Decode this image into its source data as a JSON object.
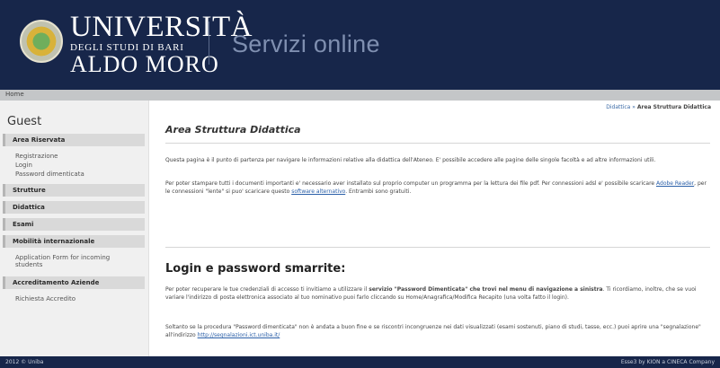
{
  "header": {
    "logo_line1": "UNIVERSITÀ",
    "logo_line2": "DEGLI STUDI DI BARI",
    "logo_line3": "ALDO MORO",
    "service_title": "Servizi online"
  },
  "breadbar": {
    "home": "Home"
  },
  "sidebar": {
    "title": "Guest",
    "area_riservata": "Area Riservata",
    "registrazione": "Registrazione",
    "login": "Login",
    "password_dimenticata": "Password dimenticata",
    "strutture": "Strutture",
    "didattica": "Didattica",
    "esami": "Esami",
    "mobilita": "Mobilità internazionale",
    "application_form_1": "Application Form for incoming",
    "application_form_2": "students",
    "accreditamento": "Accreditamento Aziende",
    "richiesta_accredito": "Richiesta Accredito"
  },
  "main": {
    "crumb_link": "Didattica",
    "crumb_sep": "»",
    "crumb_current": "Area Struttura Didattica",
    "title": "Area Struttura Didattica",
    "intro": "Questa pagina è il punto di partenza per navigare le informazioni relative alla didattica dell'Ateneo. E' possibile accedere alle pagine delle singole facoltà e ad altre informazioni utili.",
    "pdf_text_1": "Per poter stampare tutti i documenti importanti e' necessario aver installato sul proprio computer un programma per la lettura dei file pdf. Per connessioni adsl e' possibile scaricare ",
    "adobe_link": "Adobe Reader",
    "pdf_text_2": ", per le connessioni \"lente\" si puo' scaricare questo ",
    "alt_link": "software alternativo",
    "pdf_text_3": ". Entrambi sono gratuiti.",
    "login_title": "Login e password smarrite:",
    "recover_text_1": "Per poter recuperare le tue credenziali di accesso ti invitiamo a utilizzare il ",
    "recover_bold": "servizio \"Password Dimenticata\" che trovi nel menu di navigazione a sinistra",
    "recover_text_2": ". Ti ricordiamo, inoltre, che se vuoi variare l'indirizzo di posta elettronica associato al tuo nominativo puoi farlo cliccando su Home/Anagrafica/Modifica Recapito (una volta fatto il login).",
    "report_text": "Soltanto se la procedura \"Password dimenticata\" non è andata a buon fine e se riscontri incongruenze nei dati visualizzati (esami sostenuti, piano di studi, tasse, ecc.) puoi aprire una \"segnalazione\" all'indirizzo ",
    "report_link": "http://segnalazioni.ict.uniba.it/"
  },
  "footer": {
    "left": "2012 © Uniba",
    "right": "Esse3 by KION a CINECA Company"
  }
}
